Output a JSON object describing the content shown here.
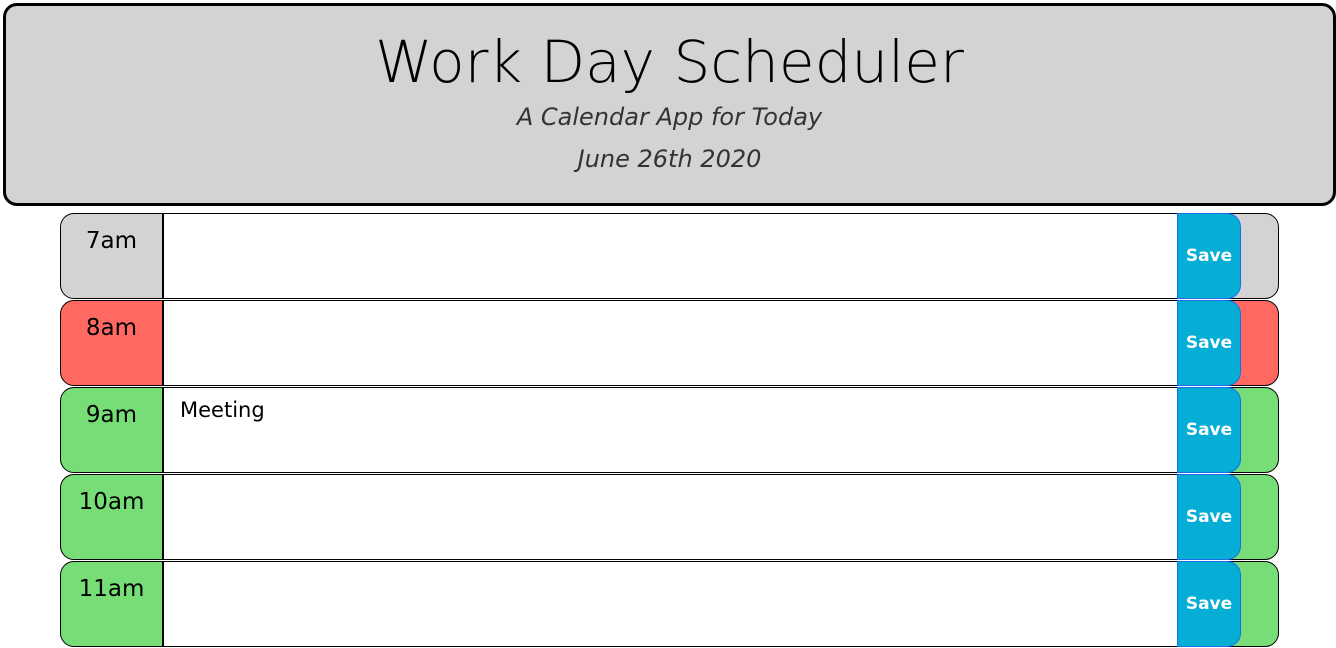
{
  "header": {
    "title": "Work Day Scheduler",
    "subtitle": "A Calendar App for Today",
    "date": "June 26th 2020"
  },
  "colors": {
    "past": "#d3d3d3",
    "present": "#ff6961",
    "future": "#77dd77",
    "save": "#06aed5"
  },
  "rows": [
    {
      "hour": "7am",
      "text": "",
      "state": "past",
      "save_label": "Save"
    },
    {
      "hour": "8am",
      "text": "",
      "state": "present",
      "save_label": "Save"
    },
    {
      "hour": "9am",
      "text": "Meeting",
      "state": "future",
      "save_label": "Save"
    },
    {
      "hour": "10am",
      "text": "",
      "state": "future",
      "save_label": "Save"
    },
    {
      "hour": "11am",
      "text": "",
      "state": "future",
      "save_label": "Save"
    }
  ]
}
